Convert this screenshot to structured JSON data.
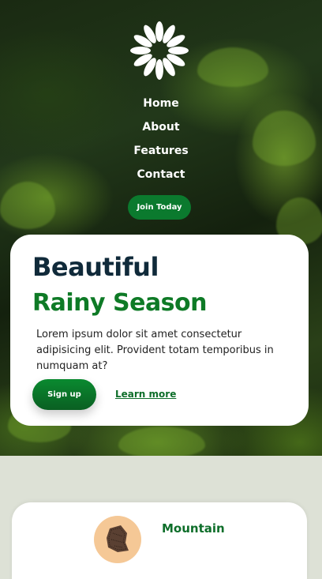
{
  "nav": {
    "links": [
      "Home",
      "About",
      "Features",
      "Contact"
    ],
    "join_label": "Join Today"
  },
  "hero": {
    "title_line1": "Beautiful",
    "title_line2": "Rainy Season",
    "body": "Lorem ipsum dolor sit amet consectetur adipisicing elit. Provident totam temporibus in numquam at?",
    "signup_label": "Sign up",
    "learn_label": "Learn more"
  },
  "feature": {
    "title": "Mountain",
    "icon": "mountain-icon"
  },
  "colors": {
    "accent_green": "#0b7a2e",
    "title_navy": "#102a3a",
    "page_bg": "#dde1d6",
    "avatar_bg": "#f5c896"
  },
  "logo_icon": "flower-logo-icon"
}
